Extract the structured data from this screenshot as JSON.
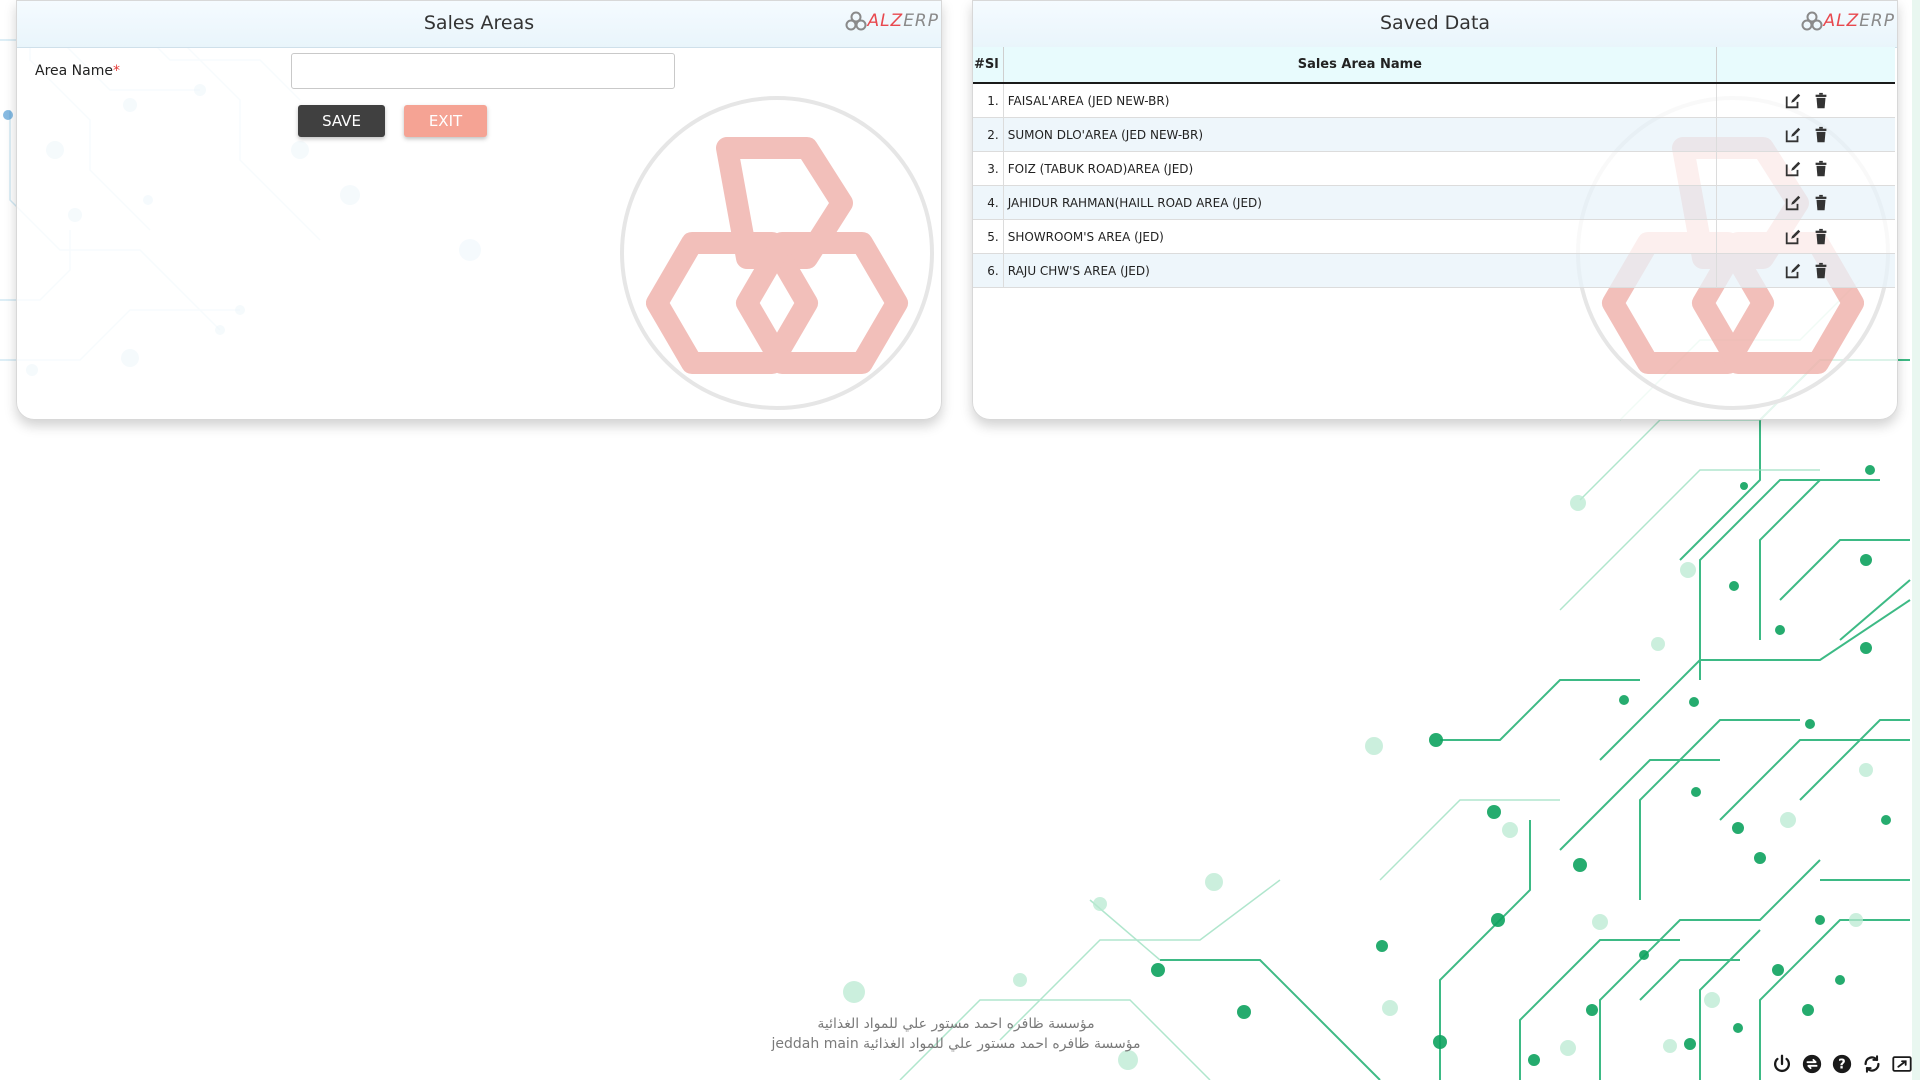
{
  "left_panel": {
    "title": "Sales Areas",
    "brand": {
      "prefix": "ALZ",
      "suffix": "ERP"
    },
    "form": {
      "area_label": "Area Name",
      "required_mark": "*",
      "area_value": "",
      "area_placeholder": ""
    },
    "buttons": {
      "save": "SAVE",
      "exit": "EXIT"
    }
  },
  "right_panel": {
    "title": "Saved Data",
    "brand": {
      "prefix": "ALZ",
      "suffix": "ERP"
    },
    "table": {
      "headers": {
        "sl": "#Sl",
        "name": "Sales Area Name",
        "actions": ""
      },
      "rows": [
        {
          "sl": "1.",
          "name": "FAISAL'AREA (JED NEW-BR)"
        },
        {
          "sl": "2.",
          "name": "SUMON DLO'AREA (JED NEW-BR)"
        },
        {
          "sl": "3.",
          "name": "FOIZ (TABUK ROAD)AREA (JED)"
        },
        {
          "sl": "4.",
          "name": "JAHIDUR RAHMAN(HAILL ROAD AREA (JED)"
        },
        {
          "sl": "5.",
          "name": "SHOWROOM'S AREA (JED)"
        },
        {
          "sl": "6.",
          "name": "RAJU CHW'S AREA (JED)"
        }
      ]
    }
  },
  "footer": {
    "line1": "مؤسسة ظافره احمد مستور علي للمواد الغذائية",
    "line2": "مؤسسة ظافره احمد مستور علي للمواد الغذائية jeddah main"
  },
  "icons": {
    "edit": "edit-icon",
    "delete": "trash-icon",
    "tray": [
      "power-icon",
      "switch-icon",
      "help-icon",
      "refresh-icon",
      "fullscreen-icon"
    ]
  },
  "colors": {
    "brand_red": "#e8494f",
    "save_button": "#404040",
    "exit_button": "#f5a394",
    "circuit_green": "#16a86a",
    "circuit_blue": "#7ab8dc"
  }
}
